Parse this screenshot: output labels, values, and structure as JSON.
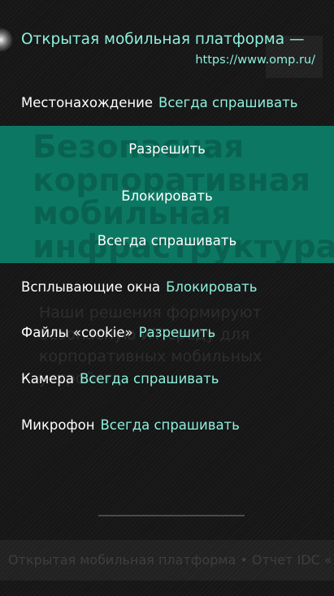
{
  "site": {
    "title": "Открытая мобильная платформа —",
    "url": "https://www.omp.ru/"
  },
  "location": {
    "label": "Местонахождение",
    "value": "Всегда спрашивать"
  },
  "dropdown": {
    "options": [
      "Разрешить",
      "Блокировать",
      "Всегда спрашивать"
    ],
    "background_heading": [
      "Безопасная",
      "корпоративная",
      "мобильная",
      "инфраструктура"
    ]
  },
  "permissions": [
    {
      "label": "Всплывающие окна",
      "value": "Блокировать"
    },
    {
      "label": "Файлы «cookie»",
      "value": "Разрешить"
    },
    {
      "label": "Камера",
      "value": "Всегда спрашивать"
    },
    {
      "label": "Микрофон",
      "value": "Всегда спрашивать"
    }
  ],
  "background_page": {
    "text": "Наши решения формируют безопасную ИТ-среду для корпоративных мобильных устройств",
    "ticker": "Открытая мобильная платформа • Отчет IDC «"
  },
  "colors": {
    "accent": "#8df0dc",
    "dropdown_bg": "#0c7863",
    "background": "#131313"
  }
}
